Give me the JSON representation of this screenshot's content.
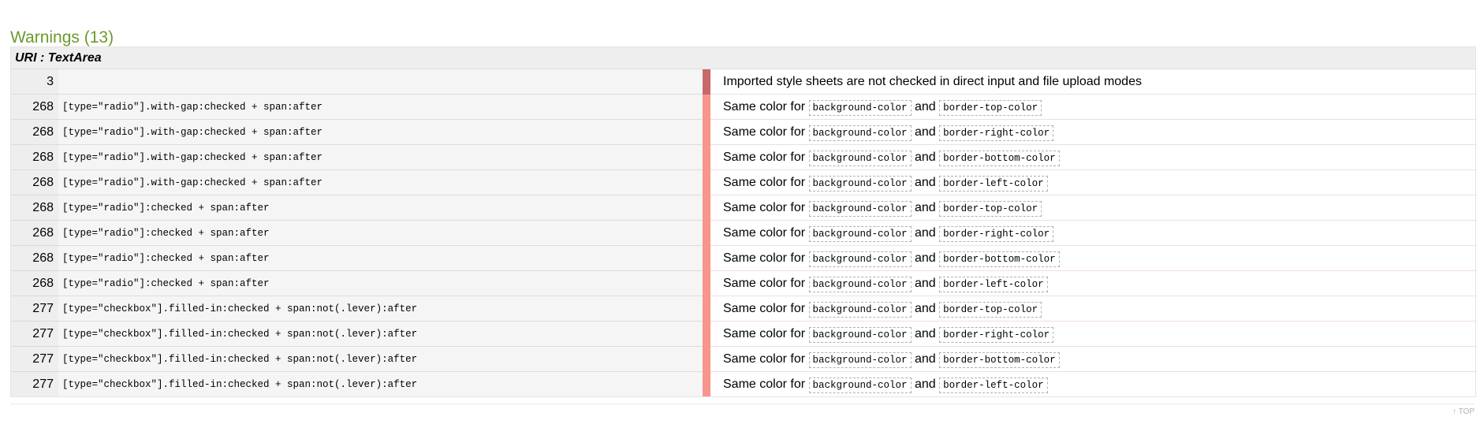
{
  "section": {
    "title": "Warnings (13)"
  },
  "uri_header": "URI : TextArea",
  "rows": [
    {
      "line": "3",
      "selector": "",
      "level": 0,
      "message": "Imported style sheets are not checked in direct input and file upload modes"
    },
    {
      "line": "268",
      "selector": "[type=\"radio\"].with-gap:checked + span:after",
      "level": 1,
      "prefix": "Same color for",
      "prop1": "background-color",
      "joiner": "and",
      "prop2": "border-top-color"
    },
    {
      "line": "268",
      "selector": "[type=\"radio\"].with-gap:checked + span:after",
      "level": 1,
      "prefix": "Same color for",
      "prop1": "background-color",
      "joiner": "and",
      "prop2": "border-right-color"
    },
    {
      "line": "268",
      "selector": "[type=\"radio\"].with-gap:checked + span:after",
      "level": 1,
      "prefix": "Same color for",
      "prop1": "background-color",
      "joiner": "and",
      "prop2": "border-bottom-color"
    },
    {
      "line": "268",
      "selector": "[type=\"radio\"].with-gap:checked + span:after",
      "level": 1,
      "prefix": "Same color for",
      "prop1": "background-color",
      "joiner": "and",
      "prop2": "border-left-color"
    },
    {
      "line": "268",
      "selector": "[type=\"radio\"]:checked + span:after",
      "level": 1,
      "prefix": "Same color for",
      "prop1": "background-color",
      "joiner": "and",
      "prop2": "border-top-color"
    },
    {
      "line": "268",
      "selector": "[type=\"radio\"]:checked + span:after",
      "level": 1,
      "prefix": "Same color for",
      "prop1": "background-color",
      "joiner": "and",
      "prop2": "border-right-color"
    },
    {
      "line": "268",
      "selector": "[type=\"radio\"]:checked + span:after",
      "level": 1,
      "prefix": "Same color for",
      "prop1": "background-color",
      "joiner": "and",
      "prop2": "border-bottom-color"
    },
    {
      "line": "268",
      "selector": "[type=\"radio\"]:checked + span:after",
      "level": 1,
      "prefix": "Same color for",
      "prop1": "background-color",
      "joiner": "and",
      "prop2": "border-left-color"
    },
    {
      "line": "277",
      "selector": "[type=\"checkbox\"].filled-in:checked + span:not(.lever):after",
      "level": 1,
      "prefix": "Same color for",
      "prop1": "background-color",
      "joiner": "and",
      "prop2": "border-top-color"
    },
    {
      "line": "277",
      "selector": "[type=\"checkbox\"].filled-in:checked + span:not(.lever):after",
      "level": 1,
      "prefix": "Same color for",
      "prop1": "background-color",
      "joiner": "and",
      "prop2": "border-right-color"
    },
    {
      "line": "277",
      "selector": "[type=\"checkbox\"].filled-in:checked + span:not(.lever):after",
      "level": 1,
      "prefix": "Same color for",
      "prop1": "background-color",
      "joiner": "and",
      "prop2": "border-bottom-color"
    },
    {
      "line": "277",
      "selector": "[type=\"checkbox\"].filled-in:checked + span:not(.lever):after",
      "level": 1,
      "prefix": "Same color for",
      "prop1": "background-color",
      "joiner": "and",
      "prop2": "border-left-color"
    }
  ],
  "footer": {
    "top_link": "↑ TOP"
  },
  "colors": {
    "title": "#6c9a2c",
    "marker_level0": "#c9686a",
    "marker_level1": "#f8958d"
  }
}
